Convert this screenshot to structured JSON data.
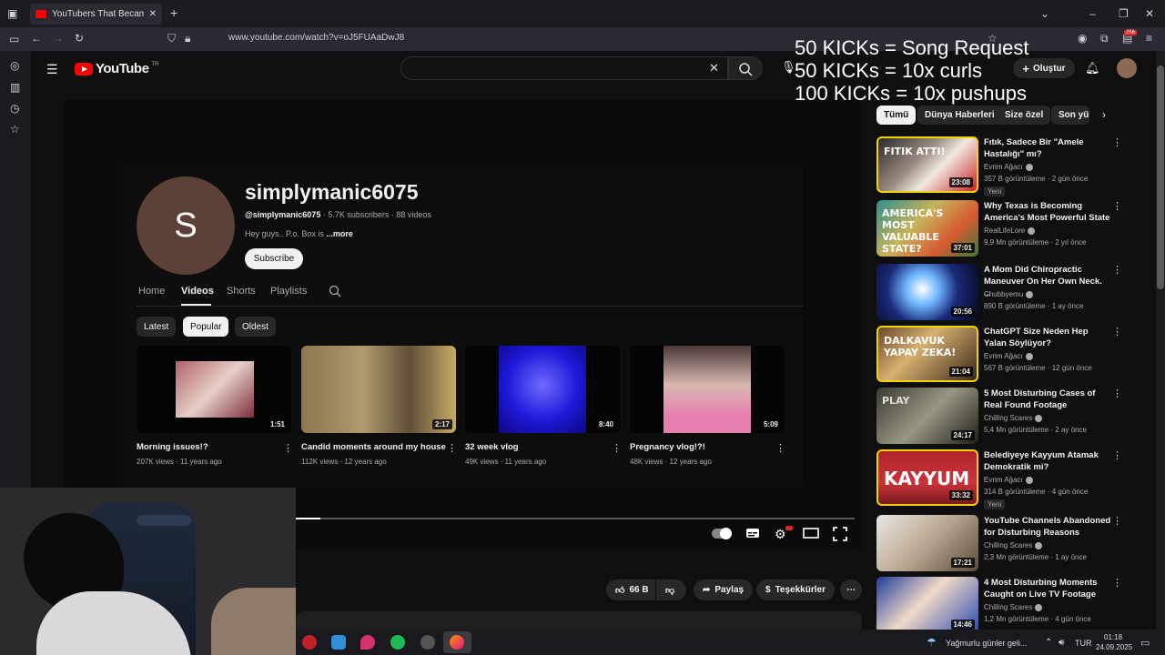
{
  "browser": {
    "tab_title": "YouTubers That Became Murde",
    "url": "www.youtube.com/watch?v=oJ5FUAaDwJ8",
    "notification_count": "256"
  },
  "overlay": {
    "line1": "50 KICKs = Song Request",
    "line2": "50 KICKs = 10x curls",
    "line3": "100 KICKs = 10x pushups"
  },
  "yt": {
    "logo_text": "YouTube",
    "logo_suffix": "TR",
    "create_label": "Oluştur"
  },
  "chips": [
    "Tümü",
    "Dünya Haberleri",
    "Size özel",
    "Son yük"
  ],
  "channel": {
    "avatar_letter": "S",
    "name": "simplymanic6075",
    "handle": "@simplymanic6075",
    "stats": " · 5.7K subscribers · 88 videos",
    "desc": "Hey guys.. P.o. Box is ",
    "more": "...more",
    "subscribe": "Subscribe",
    "tabs": [
      "Home",
      "Videos",
      "Shorts",
      "Playlists"
    ],
    "sort": [
      "Latest",
      "Popular",
      "Oldest"
    ],
    "videos": [
      {
        "title": "Morning issues!?",
        "meta": "207K views · 11 years ago",
        "duration": "1:51"
      },
      {
        "title": "Candid moments around my house",
        "meta": "112K views · 12 years ago",
        "duration": "2:17"
      },
      {
        "title": "32 week vlog",
        "meta": "49K views · 11 years ago",
        "duration": "8:40"
      },
      {
        "title": "Pregnancy vlog!?!",
        "meta": "48K views · 12 years ago",
        "duration": "5:09"
      }
    ]
  },
  "player": {
    "progress": 0.044
  },
  "actions": {
    "likes": "66 B",
    "share": "Paylaş",
    "thanks": "Teşekkürler"
  },
  "recs": [
    {
      "title": "Fıtık, Sadece Bir \"Amele Hastalığı\" mı?",
      "channel": "Evrim Ağacı",
      "meta": "357 B görüntüleme · 2 gün önce",
      "duration": "23:08",
      "badge": "Yeni",
      "thumb_text": "FITIK ATTI!"
    },
    {
      "title": "Why Texas is Becoming America's Most Powerful State",
      "channel": "RealLifeLore",
      "meta": "9,9 Mn görüntüleme · 2 yıl önce",
      "duration": "37:01",
      "badge": "",
      "thumb_text": "AMERICA'S MOST VALUABLE STATE?"
    },
    {
      "title": "A Mom Did Chiropractic Maneuver On Her Own Neck. ...",
      "channel": "Chubbyemu",
      "meta": "890 B görüntüleme · 1 ay önce",
      "duration": "20:56",
      "badge": "",
      "thumb_text": ""
    },
    {
      "title": "ChatGPT Size Neden Hep Yalan Söylüyor?",
      "channel": "Evrim Ağacı",
      "meta": "567 B görüntüleme · 12 gün önce",
      "duration": "21:04",
      "badge": "",
      "thumb_text": "DALKAVUK YAPAY ZEKA!"
    },
    {
      "title": "5 Most Disturbing Cases of Real Found Footage",
      "channel": "Chilling Scares",
      "meta": "5,4 Mn görüntüleme · 2 ay önce",
      "duration": "24:17",
      "badge": "",
      "thumb_text": "PLAY"
    },
    {
      "title": "Belediyeye Kayyum Atamak Demokratik mi?",
      "channel": "Evrim Ağacı",
      "meta": "314 B görüntüleme · 4 gün önce",
      "duration": "33:32",
      "badge": "Yeni",
      "thumb_text": "KAYYUM"
    },
    {
      "title": "YouTube Channels Abandoned for Disturbing Reasons",
      "channel": "Chilling Scares",
      "meta": "2,3 Mn görüntüleme · 1 ay önce",
      "duration": "17:21",
      "badge": "",
      "thumb_text": ""
    },
    {
      "title": "4 Most Disturbing Moments Caught on Live TV Footage",
      "channel": "Chilling Scares",
      "meta": "1,2 Mn görüntüleme · 4 gün önce",
      "duration": "14:46",
      "badge": "",
      "thumb_text": ""
    }
  ],
  "taskbar": {
    "weather": "Yağmurlu günler geli...",
    "lang": "TUR",
    "time": "01:18",
    "date": "24.09.2025"
  },
  "colors": {
    "accent": "#ff0000",
    "bg": "#0f0f0f",
    "chip": "#272727"
  }
}
